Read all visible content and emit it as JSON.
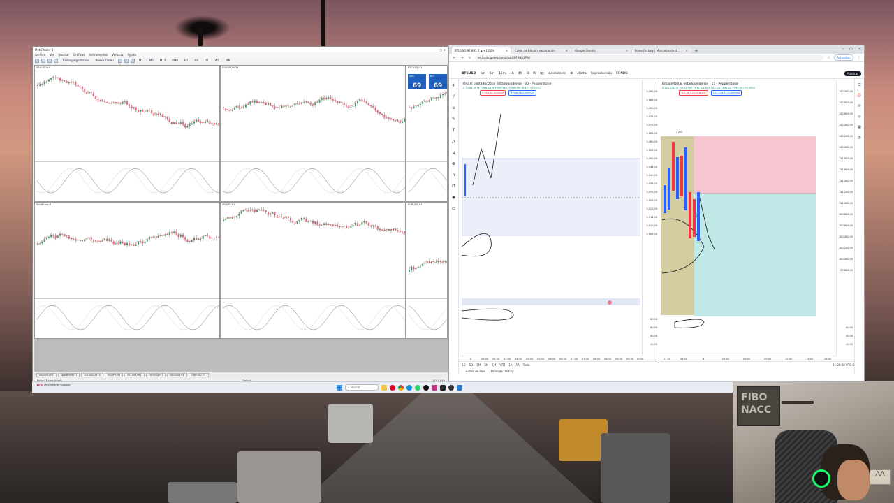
{
  "mt5": {
    "title": "MetaTrader 5",
    "menu": [
      "Archivo",
      "Ver",
      "Insertar",
      "Gráficos",
      "Instrumentos",
      "Ventana",
      "Ayuda"
    ],
    "toolbar": {
      "algo_trading": "Trading algorítmico",
      "new_order": "Nueva Orden",
      "timeframes": [
        "M1",
        "M5",
        "M15",
        "M30",
        "H1",
        "H4",
        "D1",
        "W1",
        "MN"
      ]
    },
    "charts": [
      {
        "title": "XAUUSD,H1"
      },
      {
        "title": "XAUUSD,M15"
      },
      {
        "title": "BTCUSD,H1"
      },
      {
        "title": "SpotBrent,H1"
      },
      {
        "title": "USDJPY,H1"
      },
      {
        "title": "EURUSD,H1"
      }
    ],
    "quote": {
      "sell_label": "SELL",
      "sell_value": "69",
      "buy_label": "BUY",
      "buy_value": "69"
    },
    "tabs": [
      "XAUUSD,H1",
      "SpotBrent,H1",
      "XAUUSD,M15",
      "USDJPY,H1",
      "BTCUSD,H1",
      "EURUSD,H1",
      "NASUSD,H1",
      "GBPUSD,H1"
    ],
    "status": {
      "left": "Pulse F1 para Ayuda",
      "center": "Default",
      "right": "174 / 1 Kb"
    }
  },
  "taskbar": {
    "weather_temp": "18°C",
    "weather_desc": "Mayormente nublado",
    "search_placeholder": "Buscar",
    "tray": "ESP"
  },
  "chrome": {
    "tabs": [
      {
        "label": "BTCUSD 97,895.4 ▲ +1.62%"
      },
      {
        "label": "Caída de Bitcoin: explicación"
      },
      {
        "label": "Google Gemini"
      },
      {
        "label": "Forex Factory | Mercados de d..."
      }
    ],
    "url": "es.tradingview.com/chart/8F9Hb1PW/",
    "update_btn": "Actualizar"
  },
  "tradingview": {
    "symbol": "BTCUSD",
    "timeframes": [
      "1m",
      "5m",
      "15m",
      "1h",
      "4h",
      "D",
      "W"
    ],
    "indicators": "Indicadores",
    "alert": "Alerta",
    "replay": "Reproducción",
    "publish": "Publicar",
    "layout": "FONDO",
    "pane_left": {
      "title": "Oro al contado/Dólar estadounidense · 30 · Pepperstone",
      "ohlc": "A 3,964.30  M 3,968.88  M 3,955.56  C 3,956.49 −8.43 (−0.21%)",
      "sell": "3,956.08 VENDER",
      "buy": "3,956.58 COMPRAR",
      "prices": [
        "3,990.00",
        "3,985.00",
        "3,980.00",
        "3,975.00",
        "3,970.00",
        "3,965.00",
        "3,960.00",
        "3,955.00",
        "3,950.00",
        "3,945.00",
        "3,940.00",
        "3,935.00",
        "3,930.00",
        "3,925.00",
        "3,920.00",
        "3,915.00",
        "3,910.00",
        "3,905.00",
        "80.00",
        "60.00",
        "40.00",
        "20.00"
      ],
      "times": [
        "6",
        "03:00",
        "03:30",
        "04:00",
        "04:30",
        "05:00",
        "05:30",
        "06:00",
        "06:30",
        "07:00",
        "07:30",
        "08:00",
        "08:30",
        "09:00",
        "09:30",
        "10:00"
      ]
    },
    "pane_right": {
      "title": "Bitcoin/Dólar estadounidense · 15 · Pepperstone",
      "ohlc": "A 101,231.77  M 101,950.16  M 101,085.34  C 101,836.34 +594.59 (+0.59%)",
      "sell": "101,867.24 VENDER",
      "buy": "101,876.34 COMPRAR",
      "prices": [
        "103,000.00",
        "102,800.00",
        "102,600.00",
        "102,400.00",
        "102,200.00",
        "102,000.00",
        "101,800.00",
        "101,600.00",
        "101,400.00",
        "101,200.00",
        "101,000.00",
        "100,800.00",
        "100,600.00",
        "100,400.00",
        "100,200.00",
        "100,000.00",
        "99,800.00",
        "60.00",
        "40.00",
        "20.00"
      ],
      "times": [
        "21:00",
        "03:00",
        "6",
        "03:00",
        "06:00",
        "09:00",
        "12:00",
        "15:00",
        "18:00"
      ],
      "label_high": "42.9"
    },
    "bottom_ranges": [
      "1D",
      "5D",
      "1M",
      "3M",
      "6M",
      "YTD",
      "1A",
      "5A",
      "Todo"
    ],
    "clock": "21:39:58 UTC-5",
    "panels": [
      "Editor de Pine",
      "Panel de trading"
    ]
  },
  "colors": {
    "tv_green": "#089981",
    "tv_red": "#f23645",
    "tv_blue": "#2962ff",
    "zone_red": "#f6c6d0",
    "zone_teal": "#bfe8e6",
    "zone_olive": "#c9c08a",
    "mt5_blue": "#1f5fbf"
  }
}
